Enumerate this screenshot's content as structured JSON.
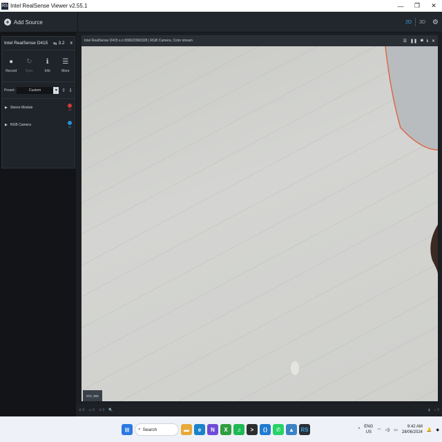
{
  "titlebar": {
    "app_icon": "RS",
    "title": "Intel RealSense Viewer v2.55.1",
    "minimize": "—",
    "restore": "❐",
    "close": "✕"
  },
  "toolbar": {
    "add_source_icon": "plus-circle-icon",
    "add_source_label": "Add Source",
    "view_2d": "2D",
    "view_3d": "3D",
    "active_view": "2D",
    "accent_color": "#3da4e8"
  },
  "device": {
    "name": "Intel RealSense D415",
    "usb_version": "3.2",
    "close": "x",
    "actions": [
      {
        "label": "Record",
        "icon": "record-icon",
        "glyph": "●",
        "enabled": true
      },
      {
        "label": "Sync",
        "icon": "sync-icon",
        "glyph": "↻",
        "enabled": false
      },
      {
        "label": "Info",
        "icon": "info-icon",
        "glyph": "ℹ",
        "enabled": true
      },
      {
        "label": "More",
        "icon": "menu-icon",
        "glyph": "☰",
        "enabled": true
      }
    ],
    "preset": {
      "label": "Preset:",
      "value": "Custom"
    },
    "modules": [
      {
        "name": "Stereo Module",
        "state": "off",
        "state_label": "off",
        "color": "#d23a3a"
      },
      {
        "name": "RGB Camera",
        "state": "on",
        "state_label": "on",
        "color": "#2a8fd3"
      }
    ]
  },
  "stream": {
    "header_title": "Intel RealSense D415 s.n 839622060328 | RGB Camera, Color stream",
    "controls": [
      "list-icon",
      "pause-icon",
      "camera-icon",
      "info-icon",
      "close-icon"
    ],
    "resolution": "872, 906"
  },
  "statusbar": {
    "items": [
      "⊘ 0",
      "⚠ 0",
      "⊙ 0",
      "🔍"
    ],
    "right": [
      "▮",
      "◐ 0"
    ]
  },
  "taskbar": {
    "search_label": "Search",
    "tray": {
      "lang_top": "ENG",
      "lang_bottom": "US",
      "time": "9:42 AM",
      "date": "28/06/2024"
    }
  }
}
